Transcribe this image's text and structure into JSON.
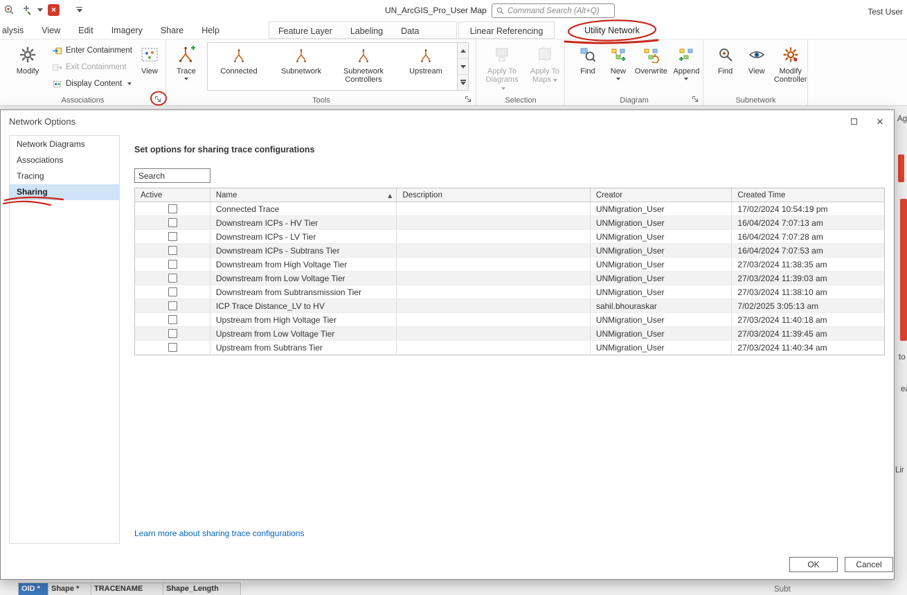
{
  "titlebar": {
    "title": "UN_ArcGIS_Pro_User Map",
    "search_placeholder": "Command Search (Alt+Q)",
    "user": "Test User"
  },
  "tabs": {
    "main": [
      "alysis",
      "View",
      "Edit",
      "Imagery",
      "Share",
      "Help"
    ],
    "contextual": [
      [
        "Feature Layer",
        "Labeling",
        "Data"
      ],
      [
        "Linear Referencing"
      ]
    ],
    "active": "Utility Network"
  },
  "ribbon": {
    "associations": {
      "label": "Associations",
      "modify": "Modify",
      "enter_containment": "Enter Containment",
      "exit_containment": "Exit Containment",
      "display_content": "Display Content",
      "view": "View"
    },
    "tools": {
      "label": "Tools",
      "trace": "Trace",
      "gallery": [
        "Connected",
        "Subnetwork",
        "Subnetwork Controllers",
        "Upstream"
      ]
    },
    "selection": {
      "label": "Selection",
      "apply_to_diagrams": "Apply To Diagrams",
      "apply_to_maps": "Apply To Maps"
    },
    "diagram": {
      "label": "Diagram",
      "find": "Find",
      "new": "New",
      "overwrite": "Overwrite",
      "append": "Append"
    },
    "subnetwork": {
      "label": "Subnetwork",
      "find": "Find",
      "view": "View",
      "modify_controller": "Modify Controller"
    }
  },
  "dialog": {
    "title": "Network Options",
    "nav": [
      "Network Diagrams",
      "Associations",
      "Tracing",
      "Sharing"
    ],
    "selected_nav": "Sharing",
    "heading": "Set options for sharing trace configurations",
    "search_placeholder": "Search",
    "table": {
      "columns": [
        "Active",
        "Name",
        "Description",
        "Creator",
        "Created Time"
      ],
      "sorted_column": "Name",
      "rows": [
        {
          "active": false,
          "name": "Connected Trace",
          "description": "",
          "creator": "UNMigration_User",
          "created": "17/02/2024 10:54:19 pm"
        },
        {
          "active": false,
          "name": "Downstream ICPs - HV Tier",
          "description": "",
          "creator": "UNMigration_User",
          "created": "16/04/2024 7:07:13 am"
        },
        {
          "active": false,
          "name": "Downstream ICPs - LV Tier",
          "description": "",
          "creator": "UNMigration_User",
          "created": "16/04/2024 7:07:28 am"
        },
        {
          "active": false,
          "name": "Downstream ICPs - Subtrans Tier",
          "description": "",
          "creator": "UNMigration_User",
          "created": "16/04/2024 7:07:53 am"
        },
        {
          "active": false,
          "name": "Downstream from High Voltage Tier",
          "description": "",
          "creator": "UNMigration_User",
          "created": "27/03/2024 11:38:35 am"
        },
        {
          "active": false,
          "name": "Downstream from Low Voltage Tier",
          "description": "",
          "creator": "UNMigration_User",
          "created": "27/03/2024 11:39:03 am"
        },
        {
          "active": false,
          "name": "Downstream from Subtransmission Tier",
          "description": "",
          "creator": "UNMigration_User",
          "created": "27/03/2024 11:38:10 am"
        },
        {
          "active": false,
          "name": "ICP Trace Distance_LV to HV",
          "description": "",
          "creator": "sahil.bhouraskar",
          "created": "7/02/2025 3:05:13 am"
        },
        {
          "active": false,
          "name": "Upstream from High Voltage Tier",
          "description": "",
          "creator": "UNMigration_User",
          "created": "27/03/2024 11:40:18 am"
        },
        {
          "active": false,
          "name": "Upstream from Low Voltage Tier",
          "description": "",
          "creator": "UNMigration_User",
          "created": "27/03/2024 11:39:45 am"
        },
        {
          "active": false,
          "name": "Upstream from Subtrans Tier",
          "description": "",
          "creator": "UNMigration_User",
          "created": "27/03/2024 11:40:34 am"
        }
      ]
    },
    "link": "Learn more about sharing trace configurations",
    "ok": "OK",
    "cancel": "Cancel"
  },
  "background": {
    "table_headers": [
      "OID *",
      "Shape *",
      "TRACENAME",
      "Shape_Length"
    ],
    "fragments": {
      "top_right": "Ag",
      "mid_right_a": "to",
      "mid_right_b": "ea",
      "bottom_right": "c.Lir",
      "bottom_center": "Subt"
    }
  },
  "colors": {
    "annotation": "#c92a1c",
    "accent_blue": "#0563c1",
    "selected_nav_bg": "#cfe4f7"
  }
}
